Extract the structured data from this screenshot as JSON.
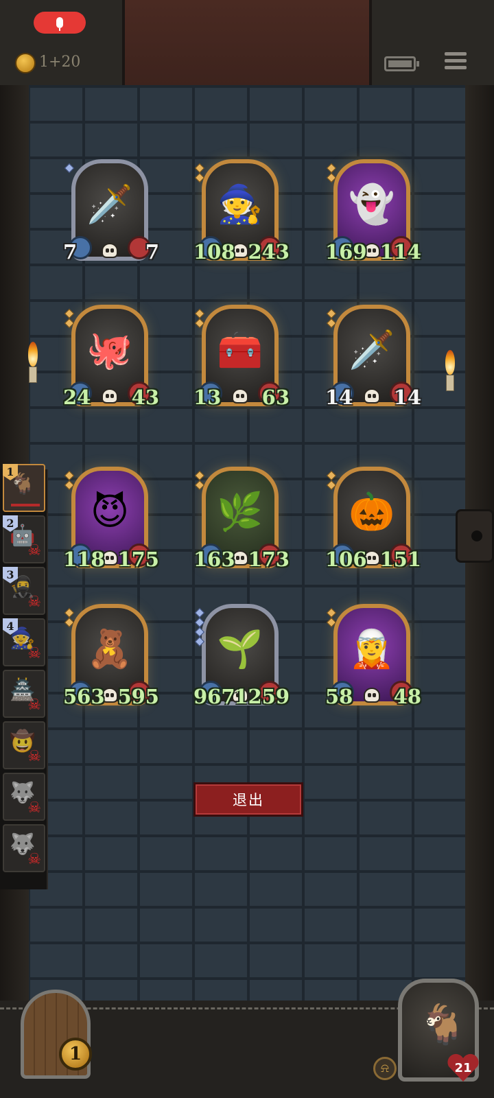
{
  "status_bar": {
    "recording_icon": "microphone-icon",
    "record_color": "#e53935"
  },
  "header": {
    "coins": "1+20",
    "battery_icon": "battery-icon",
    "menu_icon": "hamburger-menu-icon"
  },
  "board": {
    "rows": [
      [
        {
          "name": "dark-knight",
          "icon": "🗡️",
          "attack": "7",
          "health": "7",
          "frame": "silver",
          "stat_style": "white",
          "tier": 1
        },
        {
          "name": "witch",
          "icon": "🧙",
          "attack": "108",
          "health": "243",
          "frame": "gold",
          "stat_style": "green",
          "tier": 2
        },
        {
          "name": "ghost-cauldron",
          "icon": "👻",
          "attack": "169",
          "health": "114",
          "frame": "gold",
          "stat_style": "green",
          "tier": 2,
          "bg": "purple"
        }
      ],
      [
        {
          "name": "mimic-chest-tentacle",
          "icon": "🐙",
          "attack": "24",
          "health": "43",
          "frame": "gold",
          "stat_style": "green",
          "tier": 2
        },
        {
          "name": "mimic-treasure-chest",
          "icon": "🧰",
          "attack": "13",
          "health": "63",
          "frame": "gold",
          "stat_style": "green",
          "tier": 2
        },
        {
          "name": "dark-knight-gold",
          "icon": "🗡️",
          "attack": "14",
          "health": "14",
          "frame": "gold",
          "stat_style": "white",
          "tier": 2
        }
      ],
      [
        {
          "name": "grinning-imp",
          "icon": "😈",
          "attack": "118",
          "health": "175",
          "frame": "gold",
          "stat_style": "green",
          "tier": 2,
          "bg": "purple"
        },
        {
          "name": "vine-crystal",
          "icon": "🌿",
          "attack": "163",
          "health": "173",
          "frame": "gold",
          "stat_style": "green",
          "tier": 2,
          "bg": "green"
        },
        {
          "name": "pumpkin-ghost",
          "icon": "🎃",
          "attack": "106",
          "health": "151",
          "frame": "gold",
          "stat_style": "green",
          "tier": 2
        }
      ],
      [
        {
          "name": "teddy-bear",
          "icon": "🧸",
          "attack": "563",
          "health": "595",
          "frame": "gold",
          "stat_style": "green",
          "tier": 2
        },
        {
          "name": "leaf-sprite",
          "icon": "🌱",
          "attack": "967",
          "health": "1259",
          "frame": "silver",
          "stat_style": "green",
          "tier": 4
        },
        {
          "name": "dark-elf-sorceress",
          "icon": "🧝",
          "attack": "58",
          "health": "48",
          "frame": "gold",
          "stat_style": "green",
          "tier": 2,
          "bg": "purple"
        }
      ]
    ]
  },
  "exit_button": {
    "label": "退出",
    "color": "#8c1f1f"
  },
  "roster": [
    {
      "rank": "1",
      "face": "🐐",
      "state": "active"
    },
    {
      "rank": "2",
      "face": "🤖",
      "state": "defeated"
    },
    {
      "rank": "3",
      "face": "🥷",
      "state": "defeated"
    },
    {
      "rank": "4",
      "face": "🧙",
      "state": "defeated"
    },
    {
      "rank": "",
      "face": "🏯",
      "state": "defeated"
    },
    {
      "rank": "",
      "face": "🤠",
      "state": "defeated"
    },
    {
      "rank": "",
      "face": "🐺",
      "state": "defeated"
    },
    {
      "rank": "",
      "face": "🐺",
      "state": "defeated"
    }
  ],
  "footer": {
    "chest_count": "1",
    "bell_icon": "bell-icon",
    "hero_icon": "goat-hero-portrait",
    "hero_health": "21"
  }
}
